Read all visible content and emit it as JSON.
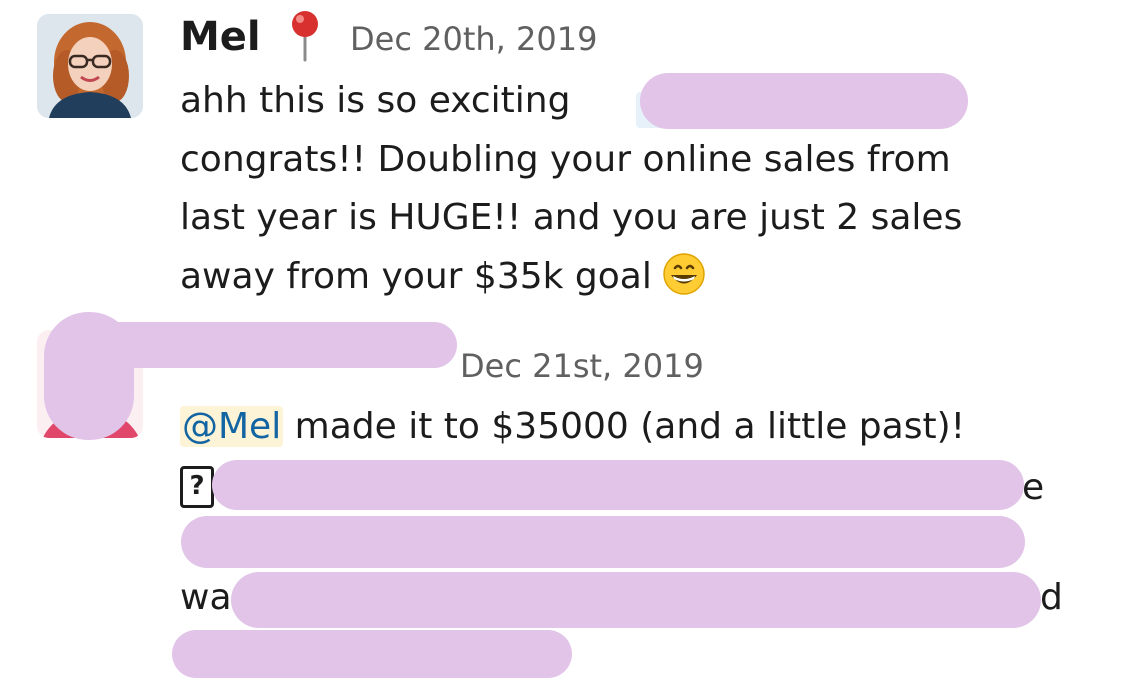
{
  "messages": [
    {
      "author": "Mel",
      "status_icon": "pushpin-icon",
      "timestamp": "Dec 20th, 2019",
      "lines": [
        "ahh this is so exciting",
        "congrats!! Doubling your online sales from",
        "last year is HUGE!! and you are just 2 sales",
        "away from your $35k goal"
      ],
      "emoji": "grinning-face-icon"
    },
    {
      "author": "",
      "timestamp": "Dec 21st, 2019",
      "mention": "@Mel",
      "text": " made it to $35000 (and a little past)!",
      "fragments": {
        "line3_start": "wa",
        "line3_end": "d",
        "line1_end": "e"
      },
      "unknown_emoji_glyph": "?"
    }
  ],
  "colors": {
    "redaction": "#e1c4e7",
    "mention_bg": "#fdf3d6",
    "mention_text": "#1264a3",
    "text": "#1d1c1d",
    "timestamp": "#616061"
  }
}
